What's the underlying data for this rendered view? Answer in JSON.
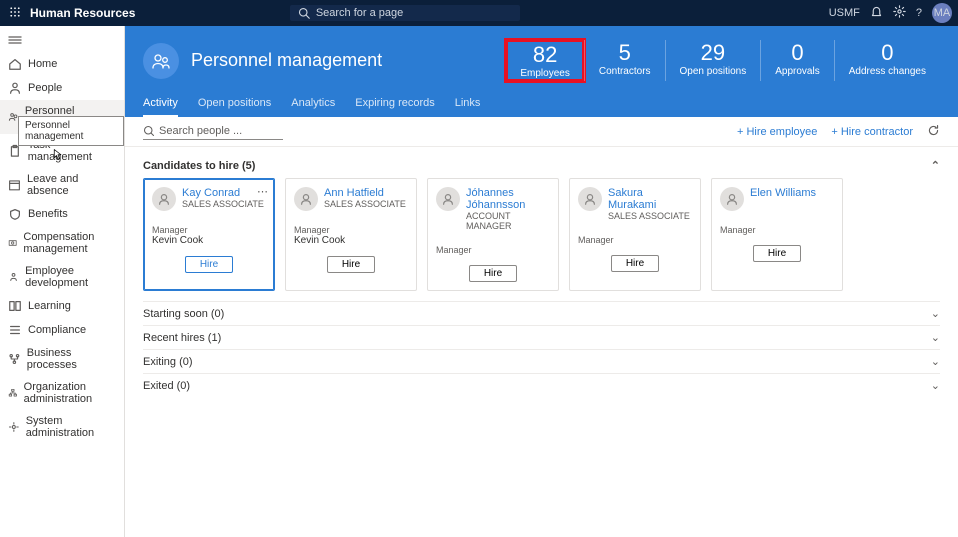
{
  "topbar": {
    "app_name": "Human Resources",
    "search_placeholder": "Search for a page",
    "company": "USMF",
    "avatar_initials": "MA"
  },
  "sidebar": {
    "items": [
      {
        "label": "Home"
      },
      {
        "label": "People"
      },
      {
        "label": "Personnel management"
      },
      {
        "label": "Task management"
      },
      {
        "label": "Leave and absence"
      },
      {
        "label": "Benefits"
      },
      {
        "label": "Compensation management"
      },
      {
        "label": "Employee development"
      },
      {
        "label": "Learning"
      },
      {
        "label": "Compliance"
      },
      {
        "label": "Business processes"
      },
      {
        "label": "Organization administration"
      },
      {
        "label": "System administration"
      }
    ],
    "tooltip": "Personnel management"
  },
  "hero": {
    "title": "Personnel management",
    "stats": [
      {
        "value": "82",
        "label": "Employees"
      },
      {
        "value": "5",
        "label": "Contractors"
      },
      {
        "value": "29",
        "label": "Open positions"
      },
      {
        "value": "0",
        "label": "Approvals"
      },
      {
        "value": "0",
        "label": "Address changes"
      }
    ],
    "tabs": [
      {
        "label": "Activity"
      },
      {
        "label": "Open positions"
      },
      {
        "label": "Analytics"
      },
      {
        "label": "Expiring records"
      },
      {
        "label": "Links"
      }
    ]
  },
  "toolbar": {
    "search_placeholder": "Search people ...",
    "hire_employee": "Hire employee",
    "hire_contractor": "Hire contractor"
  },
  "sections": {
    "candidates_header": "Candidates to hire (5)",
    "manager_label": "Manager",
    "hire_button": "Hire",
    "candidates": [
      {
        "name": "Kay Conrad",
        "title": "SALES ASSOCIATE",
        "manager": "Kevin Cook"
      },
      {
        "name": "Ann Hatfield",
        "title": "SALES ASSOCIATE",
        "manager": "Kevin Cook"
      },
      {
        "name": "Jóhannes Jóhannsson",
        "title": "ACCOUNT MANAGER",
        "manager": ""
      },
      {
        "name": "Sakura Murakami",
        "title": "SALES ASSOCIATE",
        "manager": ""
      },
      {
        "name": "Elen Williams",
        "title": "",
        "manager": ""
      }
    ],
    "collapsed": [
      {
        "label": "Starting soon (0)"
      },
      {
        "label": "Recent hires (1)"
      },
      {
        "label": "Exiting (0)"
      },
      {
        "label": "Exited (0)"
      }
    ]
  }
}
